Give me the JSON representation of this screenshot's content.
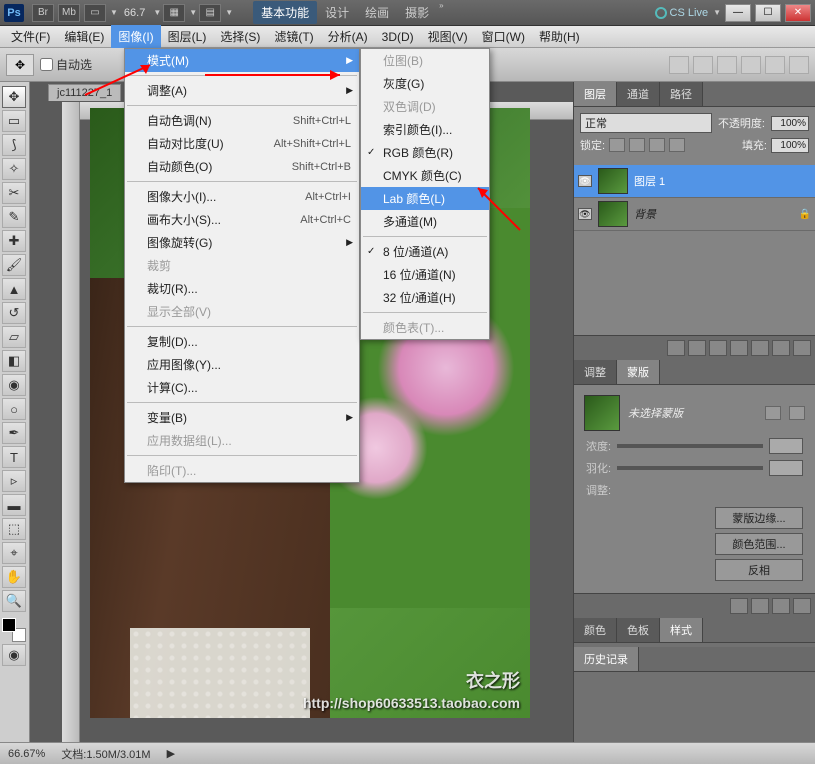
{
  "titlebar": {
    "zoom": "66.7",
    "workspaces": [
      "基本功能",
      "设计",
      "绘画",
      "摄影"
    ],
    "cslive": "CS Live"
  },
  "menubar": [
    "文件(F)",
    "编辑(E)",
    "图像(I)",
    "图层(L)",
    "选择(S)",
    "滤镜(T)",
    "分析(A)",
    "3D(D)",
    "视图(V)",
    "窗口(W)",
    "帮助(H)"
  ],
  "options": {
    "auto": "自动选"
  },
  "doc_tab": "jc111227_1",
  "image_menu": {
    "mode": "模式(M)",
    "adjust": "调整(A)",
    "auto_tone": "自动色调(N)",
    "auto_tone_sc": "Shift+Ctrl+L",
    "auto_contrast": "自动对比度(U)",
    "auto_contrast_sc": "Alt+Shift+Ctrl+L",
    "auto_color": "自动颜色(O)",
    "auto_color_sc": "Shift+Ctrl+B",
    "image_size": "图像大小(I)...",
    "image_size_sc": "Alt+Ctrl+I",
    "canvas_size": "画布大小(S)...",
    "canvas_size_sc": "Alt+Ctrl+C",
    "rotate": "图像旋转(G)",
    "crop": "裁剪",
    "trim": "裁切(R)...",
    "reveal": "显示全部(V)",
    "duplicate": "复制(D)...",
    "apply": "应用图像(Y)...",
    "calc": "计算(C)...",
    "var": "变量(B)",
    "dataset": "应用数据组(L)...",
    "trap": "陷印(T)..."
  },
  "mode_menu": {
    "bitmap": "位图(B)",
    "gray": "灰度(G)",
    "duotone": "双色调(D)",
    "indexed": "索引颜色(I)...",
    "rgb": "RGB 颜色(R)",
    "cmyk": "CMYK 颜色(C)",
    "lab": "Lab 颜色(L)",
    "multi": "多通道(M)",
    "bit8": "8 位/通道(A)",
    "bit16": "16 位/通道(N)",
    "bit32": "32 位/通道(H)",
    "colortable": "颜色表(T)..."
  },
  "layers": {
    "tabs": [
      "图层",
      "通道",
      "路径"
    ],
    "mode": "正常",
    "opacity_lbl": "不透明度:",
    "opacity": "100%",
    "lock_lbl": "锁定:",
    "fill_lbl": "填充:",
    "fill": "100%",
    "layer1": "图层 1",
    "bg": "背景"
  },
  "mask": {
    "tabs": [
      "调整",
      "蒙版"
    ],
    "none": "未选择蒙版",
    "density": "浓度:",
    "feather": "羽化:",
    "adjust": "调整:",
    "edge": "蒙版边缘...",
    "range": "颜色范围...",
    "invert": "反相"
  },
  "bottom_tabs": [
    "颜色",
    "色板",
    "样式"
  ],
  "history_tab": "历史记录",
  "status": {
    "zoom": "66.67%",
    "doc": "文档:1.50M/3.01M"
  },
  "watermark": {
    "line1": "衣之形",
    "line2": "http://shop60633513.taobao.com"
  }
}
